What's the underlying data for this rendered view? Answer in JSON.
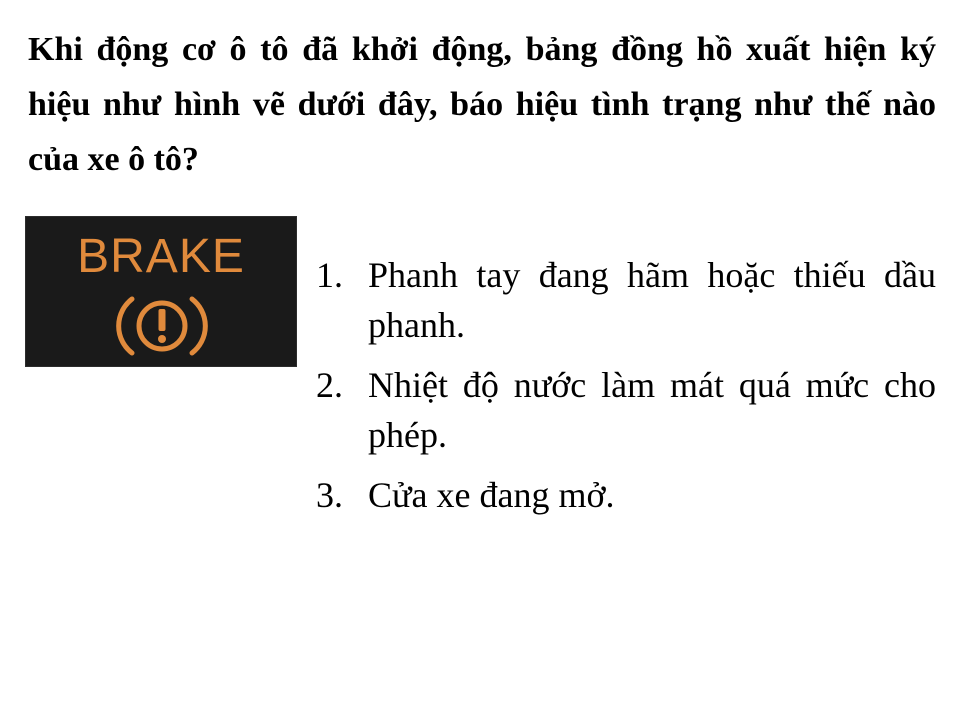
{
  "question": "Khi động cơ ô tô đã khởi động, bảng đồng hồ xuất hiện ký hiệu như hình vẽ dưới đây, báo hiệu tình trạng như thế nào của xe ô tô?",
  "warning_light": {
    "label": "BRAKE",
    "icon": "brake-warning-icon",
    "icon_color": "#e08a3c",
    "panel_color": "#1a1a1a"
  },
  "options": [
    {
      "number": "1.",
      "text": "Phanh tay đang hãm hoặc thiếu dầu phanh."
    },
    {
      "number": "2.",
      "text": "Nhiệt độ nước làm mát quá mức cho phép."
    },
    {
      "number": "3.",
      "text": "Cửa xe đang mở."
    }
  ]
}
